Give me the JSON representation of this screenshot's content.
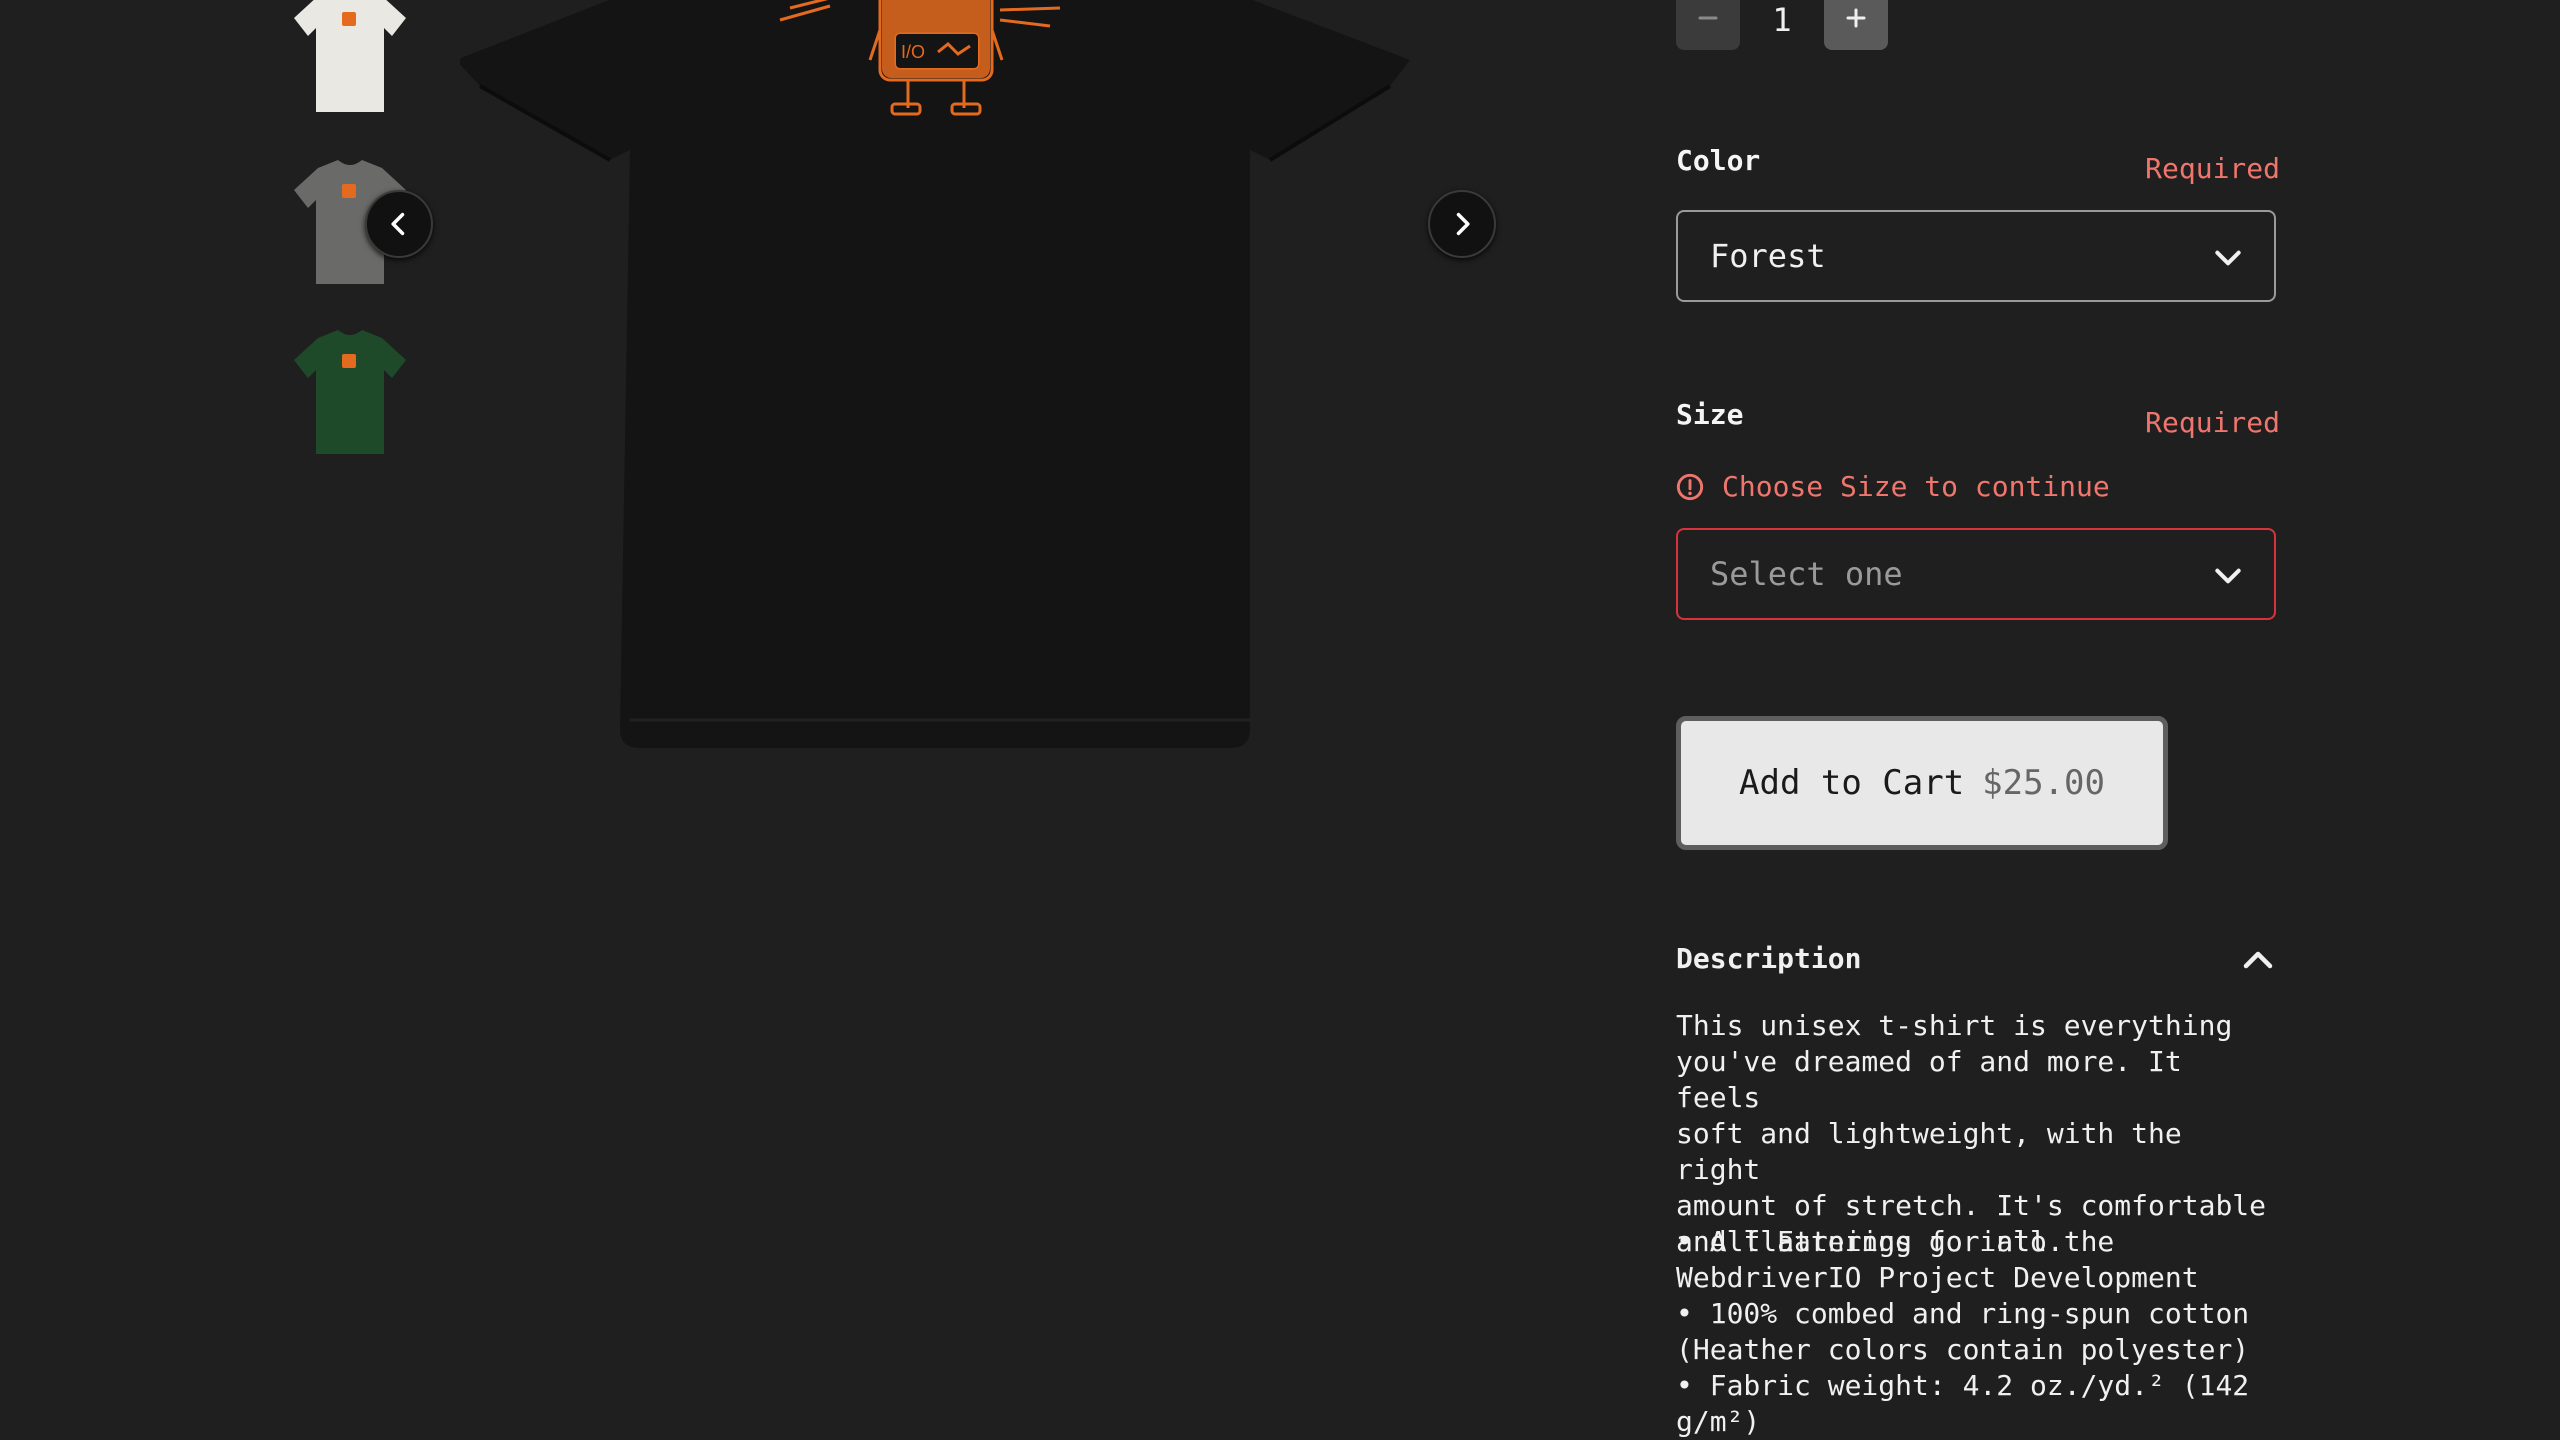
{
  "gallery": {
    "thumbnails": [
      {
        "name": "thumbnail-white-shirt",
        "color": "#e9e8e3"
      },
      {
        "name": "thumbnail-gray-shirt",
        "color": "#6a6a68"
      },
      {
        "name": "thumbnail-forest-shirt",
        "color": "#1e4a2a"
      }
    ],
    "prev_icon": "chevron-left-icon",
    "next_icon": "chevron-right-icon",
    "main_shirt_color": "#141414",
    "print_color": "#e46a1f"
  },
  "quantity": {
    "value": "1",
    "minus_icon": "minus-icon",
    "plus_icon": "plus-icon"
  },
  "color_field": {
    "label": "Color",
    "required": "Required",
    "selected": "Forest"
  },
  "size_field": {
    "label": "Size",
    "required": "Required",
    "error": "Choose Size to continue",
    "placeholder": "Select one"
  },
  "add_to_cart": {
    "label": "Add to Cart",
    "price": "$25.00"
  },
  "description": {
    "title": "Description",
    "body": "This unisex t-shirt is everything\nyou've dreamed of and more. It feels\nsoft and lightweight, with the right\namount of stretch. It's comfortable\nand flattering for all.",
    "bullets": [
      "• All Earnings go into the\nWebdriverIO Project Development",
      "• 100% combed and ring-spun cotton\n(Heather colors contain polyester)",
      "• Fabric weight: 4.2 oz./yd.² (142\ng/m²)"
    ]
  },
  "colors": {
    "background": "#1f1f1f",
    "error": "#f0766d",
    "error_border": "#d8323a"
  }
}
